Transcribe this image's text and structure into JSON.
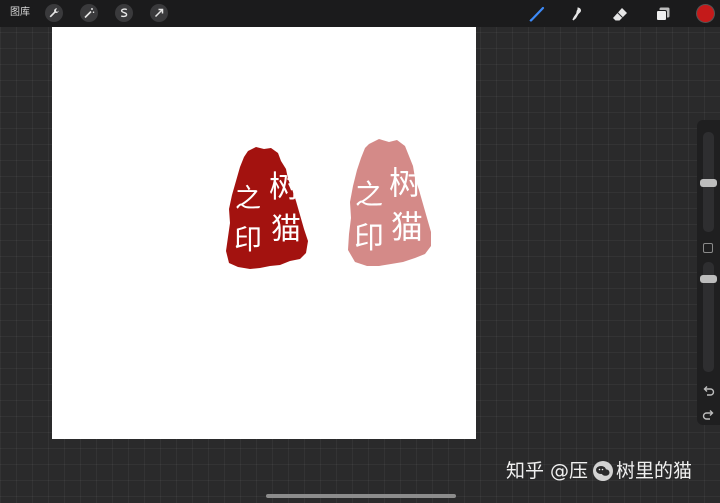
{
  "topbar": {
    "gallery_label": "图库",
    "left_tools": [
      "wrench-icon",
      "magic-wand-icon",
      "selection-icon",
      "transform-arrow-icon"
    ],
    "right_tools": [
      "brush-icon",
      "smudge-icon",
      "eraser-icon",
      "layers-icon"
    ],
    "active_color": "#c41a1a"
  },
  "canvas": {
    "background": "#ffffff",
    "stamp_colors": [
      "#a3120f",
      "#d48a88"
    ],
    "stamp_text": "树猫之印"
  },
  "sidebar": {
    "buttons": [
      "modify-button",
      "undo-icon",
      "redo-icon"
    ]
  },
  "watermark": {
    "prefix": "知乎 @压",
    "suffix": "树里的猫"
  }
}
